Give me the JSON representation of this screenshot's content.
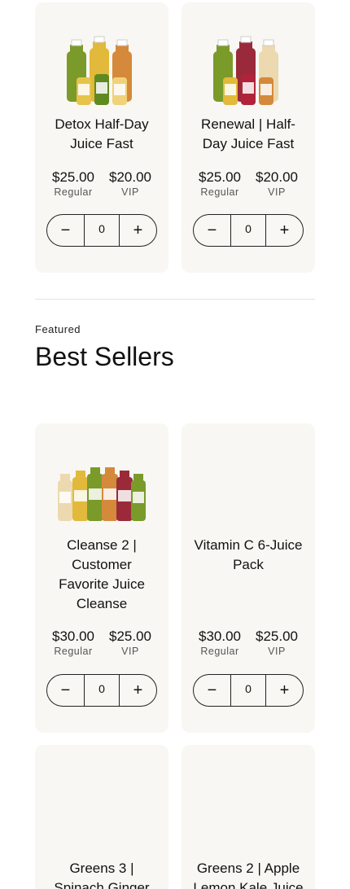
{
  "top_products": [
    {
      "title": "Detox Half-Day Juice Fast",
      "title_lines": [
        "Detox Half-Day",
        "Juice Fast"
      ],
      "image": "juice-bottles-detox",
      "regular_price": "$25.00",
      "regular_label": "Regular",
      "vip_price": "$20.00",
      "vip_label": "VIP",
      "quantity": "0"
    },
    {
      "title": "Renewal | Half-Day Juice Fast",
      "title_lines": [
        "Renewal | Half-",
        "Day Juice Fast"
      ],
      "image": "juice-bottles-renewal",
      "regular_price": "$25.00",
      "regular_label": "Regular",
      "vip_price": "$20.00",
      "vip_label": "VIP",
      "quantity": "0"
    }
  ],
  "section": {
    "eyebrow": "Featured",
    "title": "Best Sellers"
  },
  "best_sellers": [
    {
      "title_lines": [
        "Cleanse 2 |",
        "Customer",
        "Favorite Juice",
        "Cleanse"
      ],
      "image": "juice-bottles-cleanse",
      "regular_price": "$30.00",
      "regular_label": "Regular",
      "vip_price": "$25.00",
      "vip_label": "VIP",
      "quantity": "0"
    },
    {
      "title_lines": [
        "Vitamin C 6-Juice",
        "Pack"
      ],
      "image": "",
      "regular_price": "$30.00",
      "regular_label": "Regular",
      "vip_price": "$25.00",
      "vip_label": "VIP",
      "quantity": "0"
    },
    {
      "title_lines": [
        "Greens 3 |",
        "Spinach Ginger"
      ]
    },
    {
      "title_lines": [
        "Greens 2 | Apple",
        "Lemon Kale Juice"
      ]
    }
  ],
  "icons": {
    "minus": "minus-icon",
    "plus": "plus-icon"
  },
  "colors": {
    "card_bg": "#f9f7f3",
    "bottle_green": "#7a9a2a",
    "bottle_yellow": "#e2b93a",
    "bottle_orange": "#d48a3a",
    "bottle_red": "#9a2a3a",
    "bottle_cream": "#ecd9b0"
  }
}
